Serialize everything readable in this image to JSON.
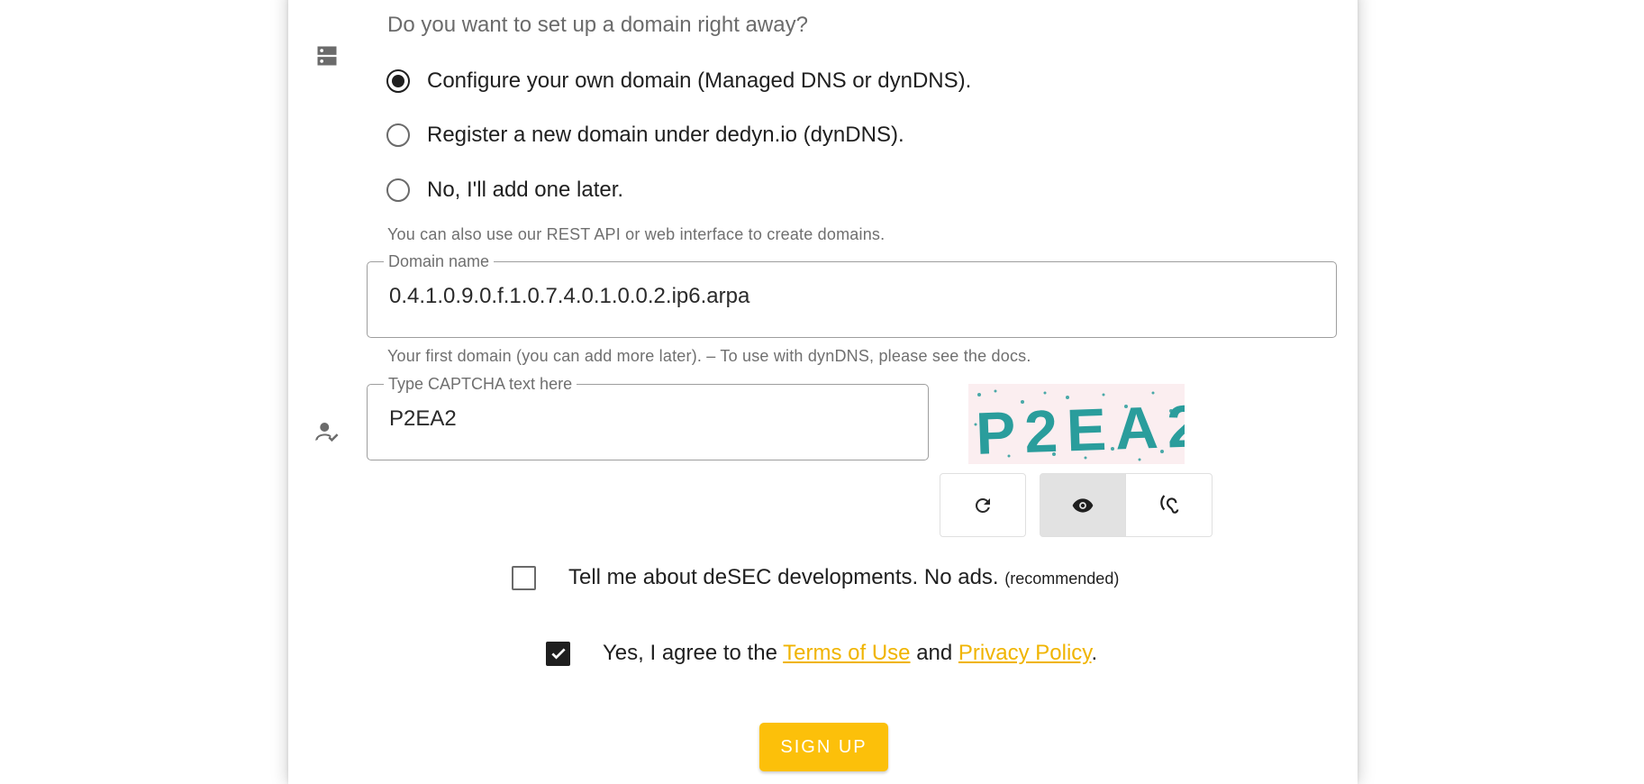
{
  "domain_section": {
    "question": "Do you want to set up a domain right away?",
    "icon": "dns-server-icon",
    "options": [
      {
        "label": "Configure your own domain (Managed DNS or dynDNS).",
        "selected": true
      },
      {
        "label": "Register a new domain under dedyn.io (dynDNS).",
        "selected": false
      },
      {
        "label": "No, I'll add one later.",
        "selected": false
      }
    ],
    "hint": "You can also use our REST API or web interface to create domains."
  },
  "domain_field": {
    "label": "Domain name",
    "value": "0.4.1.0.9.0.f.1.0.7.4.0.1.0.0.2.ip6.arpa",
    "hint": "Your first domain (you can add more later). – To use with dynDNS, please see the docs."
  },
  "captcha": {
    "icon": "user-check-icon",
    "label": "Type CAPTCHA text here",
    "value": "P2EA2",
    "image_text": "P2EA2",
    "buttons": {
      "refresh_icon": "refresh-icon",
      "visual_icon": "eye-icon",
      "audio_icon": "hearing-icon",
      "active": "visual"
    }
  },
  "newsletter": {
    "label": "Tell me about deSEC developments. No ads.",
    "suffix": "(recommended)",
    "checked": false
  },
  "terms": {
    "prefix": "Yes, I agree to the",
    "terms_link": "Terms of Use",
    "middle": "and",
    "privacy_link": "Privacy Policy",
    "end": ".",
    "checked": true
  },
  "signup_button": "SIGN UP",
  "colors": {
    "accent": "#fcc00a",
    "link": "#f0b400",
    "captcha_text": "#2a9d9c",
    "captcha_bg": "#fbeef0"
  }
}
